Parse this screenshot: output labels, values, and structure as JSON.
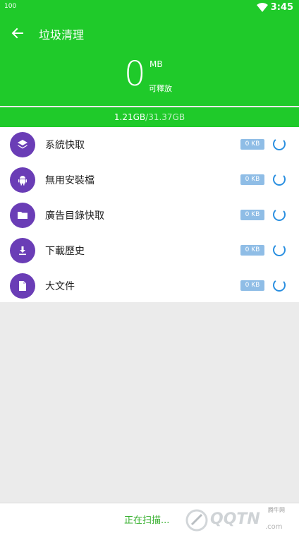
{
  "status": {
    "left_text": "100",
    "time": "3:45"
  },
  "header": {
    "title": "垃圾清理",
    "amount": "0",
    "unit": "MB",
    "sub_label": "可釋放"
  },
  "storage": {
    "used": "1.21GB",
    "total": "/31.37GB"
  },
  "items": [
    {
      "label": "系統快取",
      "size": "0 KB",
      "icon": "layers-icon"
    },
    {
      "label": "無用安裝檔",
      "size": "0 KB",
      "icon": "android-icon"
    },
    {
      "label": "廣告目錄快取",
      "size": "0 KB",
      "icon": "folder-icon"
    },
    {
      "label": "下載歷史",
      "size": "0 KB",
      "icon": "download-icon"
    },
    {
      "label": "大文件",
      "size": "0 KB",
      "icon": "file-icon"
    }
  ],
  "footer": {
    "scan_status": "正在扫描...",
    "watermark": "QQTN",
    "watermark_sub": "腾牛网",
    "watermark_com": ".com"
  },
  "colors": {
    "accent": "#1fca2a",
    "icon_bg": "#6a3db6",
    "badge": "#8fbde6"
  }
}
